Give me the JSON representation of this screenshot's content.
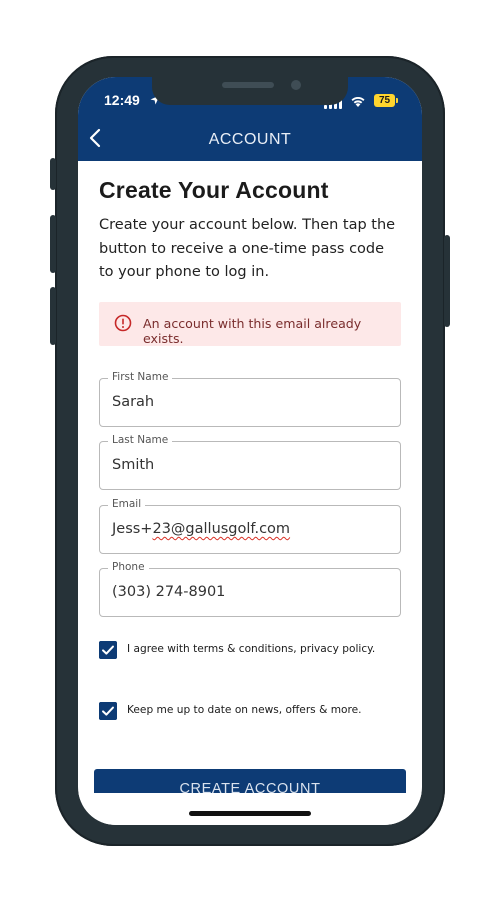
{
  "status": {
    "time": "12:49",
    "battery": "75"
  },
  "header": {
    "title": "ACCOUNT"
  },
  "page": {
    "title": "Create Your Account",
    "intro": "Create your account below. Then tap the button to receive a one-time pass code to your phone to log in."
  },
  "alert": {
    "message": "An account with this email already exists."
  },
  "form": {
    "first_name": {
      "label": "First Name",
      "value": "Sarah"
    },
    "last_name": {
      "label": "Last Name",
      "value": "Smith"
    },
    "email": {
      "label": "Email",
      "value_prefix": "Jess+",
      "value_underlined": "23@gallusgolf.com"
    },
    "phone": {
      "label": "Phone",
      "value": "(303) 274-8901"
    }
  },
  "checkboxes": {
    "terms": {
      "label": "I agree with terms & conditions, privacy policy.",
      "checked": true
    },
    "news": {
      "label": "Keep me up to date on news, offers & more.",
      "checked": true
    }
  },
  "actions": {
    "create_account": "CREATE ACCOUNT"
  },
  "colors": {
    "brand": "#0d3b75",
    "alert_bg": "#fde8e8",
    "alert_text": "#7a2d2d",
    "frame": "#263238"
  },
  "icons": [
    "location-arrow-icon",
    "signal-icon",
    "wifi-icon",
    "battery-icon",
    "back-chevron-icon",
    "alert-circle-icon",
    "checkbox-checked-icon"
  ]
}
